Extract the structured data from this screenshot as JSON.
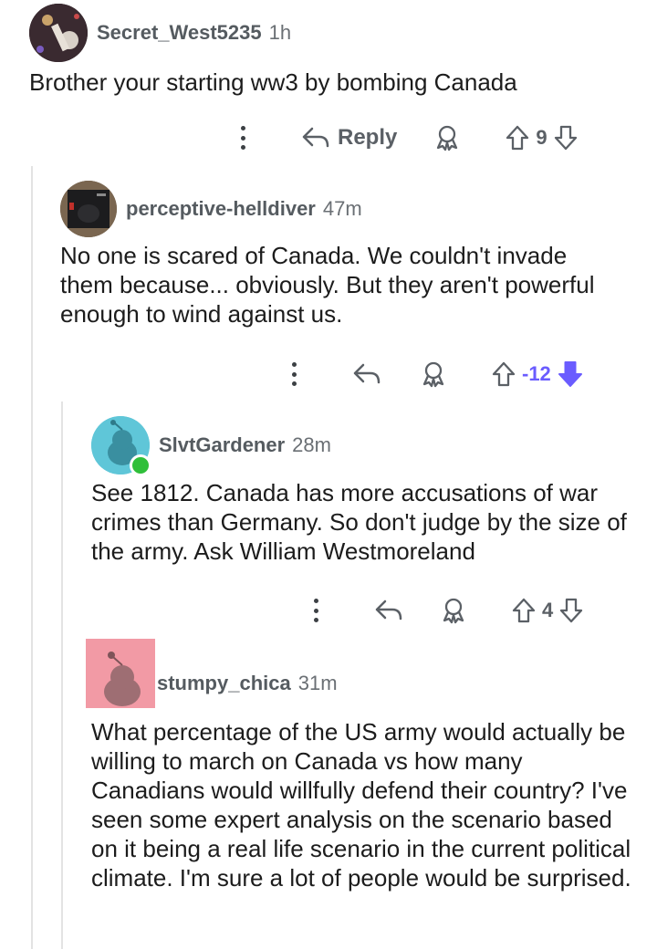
{
  "comments": [
    {
      "username": "Secret_West5235",
      "age": "1h",
      "text": "Brother your starting ww3 by bombing Canada",
      "reply_label": "Reply",
      "votes": "9",
      "vote_state": "none"
    },
    {
      "username": "perceptive-helldiver",
      "age": "47m",
      "text": "No one is scared of Canada. We couldn't invade them because... obviously. But they aren't powerful enough to wind against us.",
      "votes": "-12",
      "vote_state": "downvoted"
    },
    {
      "username": "SlvtGardener",
      "age": "28m",
      "text": "See 1812. Canada has more accusations of war crimes than Germany. So don't judge by the size of the army. Ask William Westmoreland",
      "votes": "4",
      "vote_state": "none",
      "online": true
    },
    {
      "username": "stumpy_chica",
      "age": "31m",
      "text": "What percentage of the US army would actually be willing to march on Canada vs how many Canadians would willfully defend their country? I've seen some expert analysis on the scenario based on it being a real life scenario in the current political climate. I'm sure a lot of people would be surprised."
    }
  ],
  "colors": {
    "downvote": "#6a5cff",
    "online": "#2fbf3a",
    "avatar_teal": "#5fc6d8",
    "avatar_pink": "#f29aa5"
  },
  "icons": [
    "more-options-icon",
    "reply-arrow-icon",
    "award-icon",
    "upvote-arrow-icon",
    "downvote-arrow-icon"
  ]
}
